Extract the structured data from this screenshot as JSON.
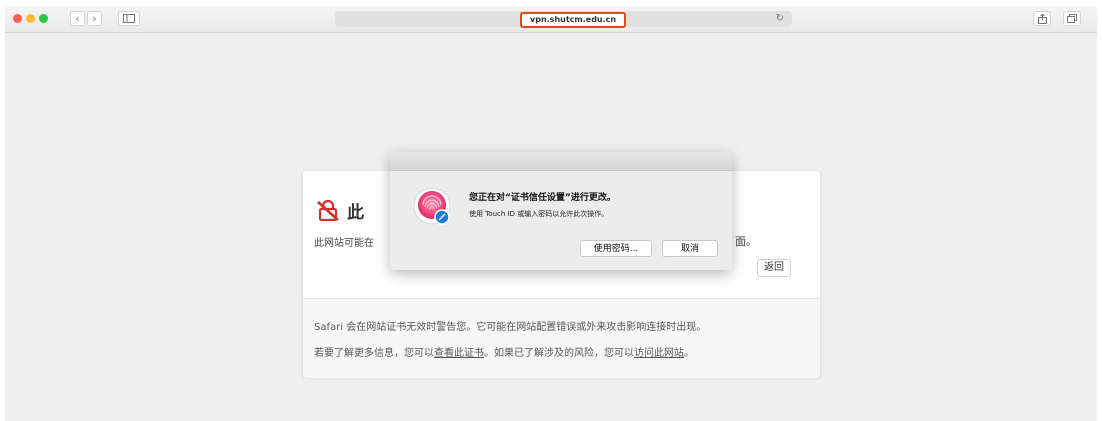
{
  "browser": {
    "url": "vpn.shutcm.edu.cn",
    "back_label": "‹",
    "forward_label": "›",
    "reload_label": "↻"
  },
  "warning": {
    "title_visible": "此",
    "desc_start": "此网站可能在",
    "desc_end": "面。",
    "back_button": "返回",
    "line1": "Safari 会在网站证书无效时警告您。它可能在网站配置错误或外来攻击影响连接时出现。",
    "line2_prefix": "若要了解更多信息，您可以",
    "line2_link1": "查看此证书",
    "line2_mid": "。如果已了解涉及的风险，您可以",
    "line2_link2": "访问此网站",
    "line2_suffix": "。"
  },
  "dialog": {
    "title": "您正在对“证书信任设置”进行更改。",
    "subtitle": "使用 Touch ID 或输入密码以允许此次操作。",
    "use_password_button": "使用密码...",
    "cancel_button": "取消"
  },
  "colors": {
    "close": "#ff5f57",
    "minimize": "#febc2e",
    "zoom": "#28c840",
    "url_highlight": "#e0491c",
    "warning_icon": "#d0312d"
  }
}
